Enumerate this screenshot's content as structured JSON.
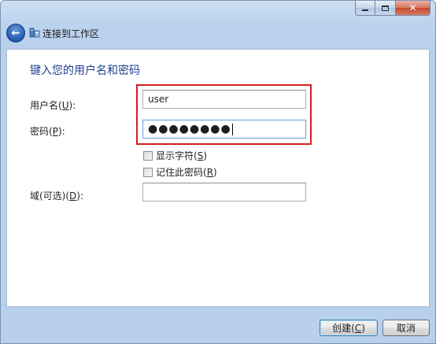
{
  "window": {
    "title": "连接到工作区",
    "caption": {
      "close_glyph": "✕"
    }
  },
  "nav": {
    "back_glyph": "←"
  },
  "form": {
    "heading": "键入您的用户名和密码",
    "username": {
      "label_prefix": "用户名(",
      "mnemonic": "U",
      "label_suffix": "):",
      "value": "user"
    },
    "password": {
      "label_prefix": "密码(",
      "mnemonic": "P",
      "label_suffix": "):",
      "masked_value": "●●●●●●●●"
    },
    "show_chars": {
      "label_prefix": "显示字符(",
      "mnemonic": "S",
      "label_suffix": ")"
    },
    "remember": {
      "label_prefix": "记住此密码(",
      "mnemonic": "R",
      "label_suffix": ")"
    },
    "domain": {
      "label_prefix": "域(可选)(",
      "mnemonic": "D",
      "label_suffix": "):",
      "value": ""
    }
  },
  "footer": {
    "create": {
      "label_prefix": "创建(",
      "mnemonic": "C",
      "label_suffix": ")"
    },
    "cancel": {
      "label": "取消"
    }
  },
  "colors": {
    "highlight": "#d22020",
    "heading": "#1e3f8f",
    "close_button": "#c24a2f"
  }
}
